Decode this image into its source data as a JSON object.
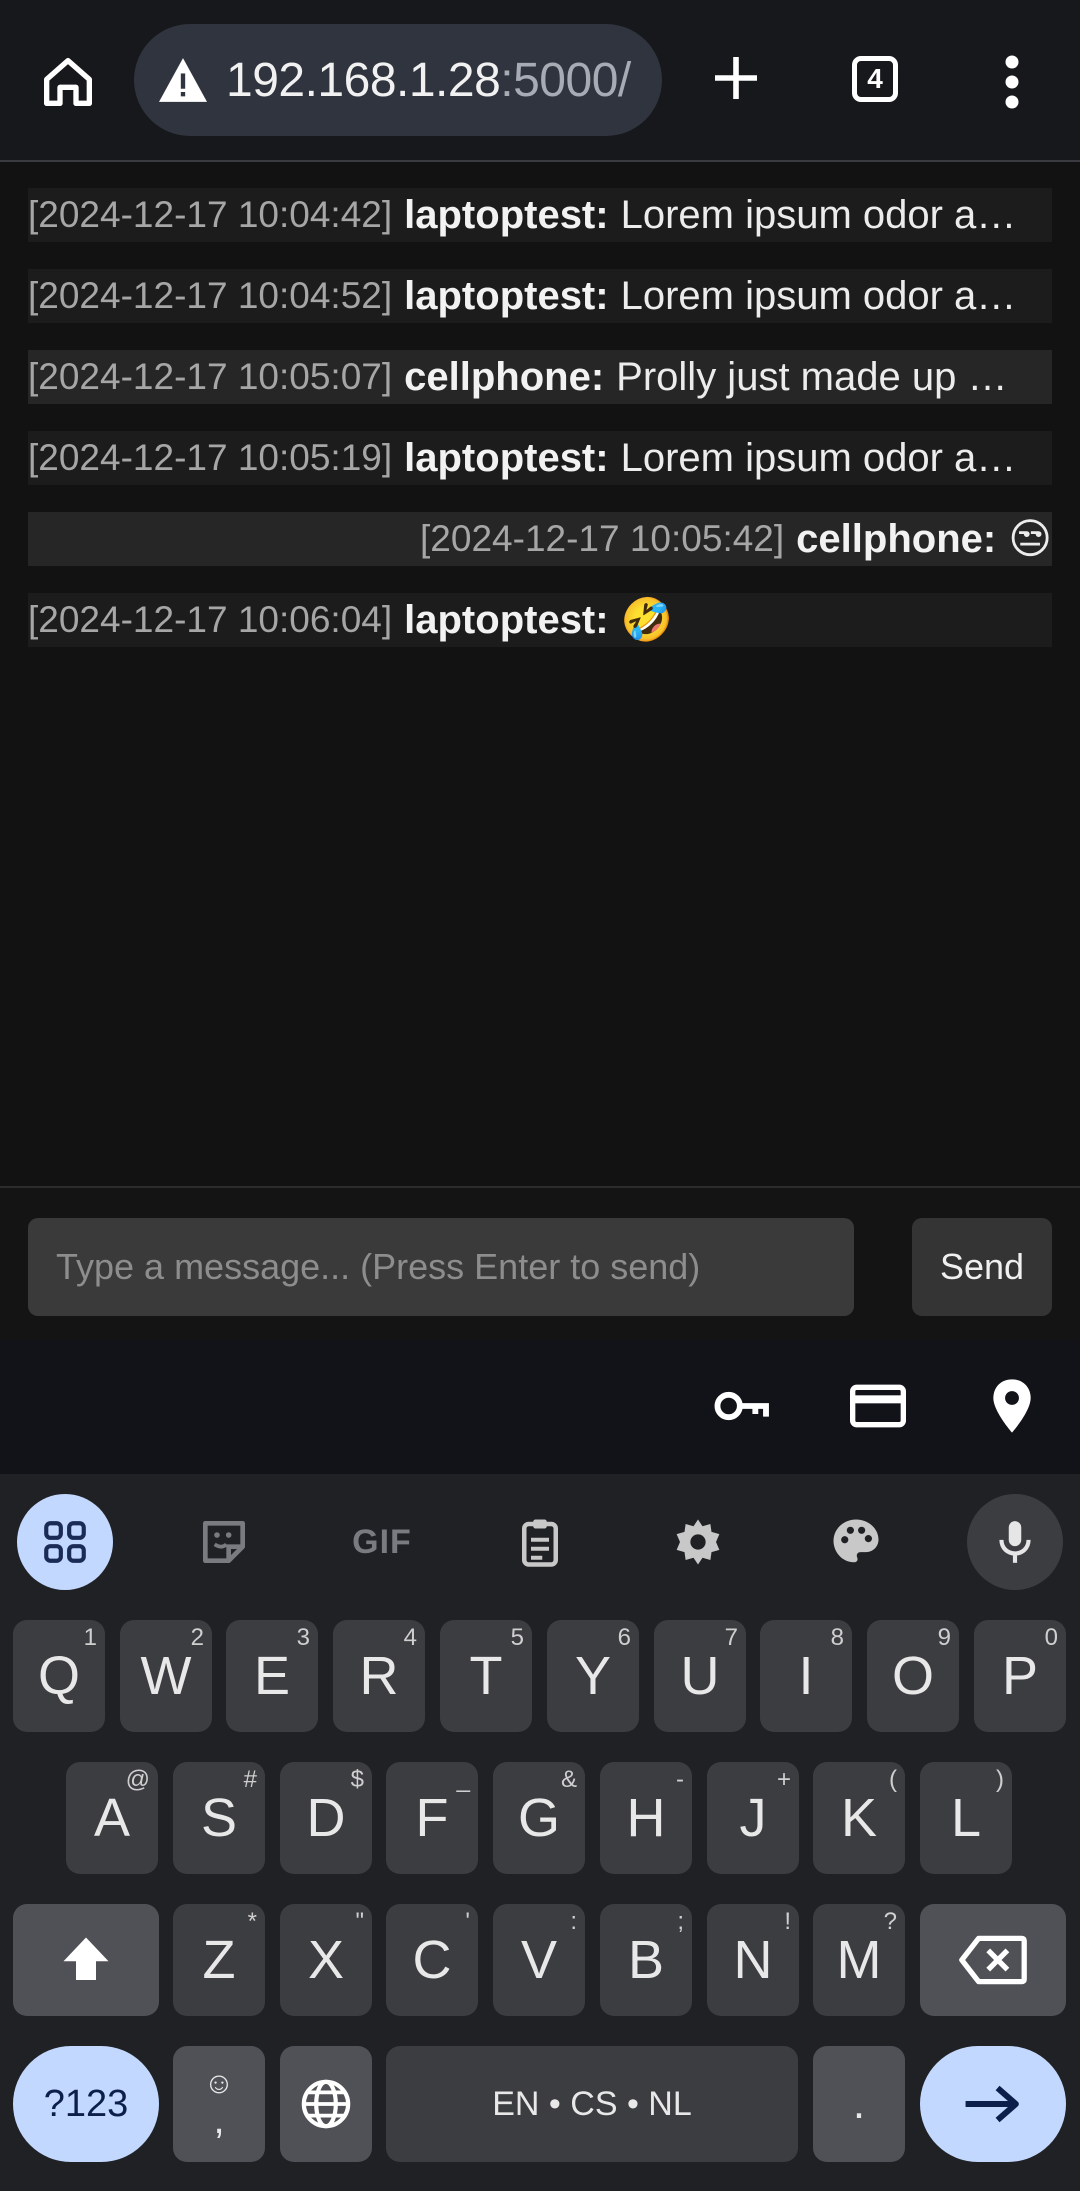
{
  "browser": {
    "url_host": "192.168.1.28",
    "url_port": ":5000/",
    "tab_count": "4"
  },
  "messages": [
    {
      "timestamp": "[2024-12-17 10:04:42]",
      "user": "laptoptest:",
      "text": "Lorem ipsum odor a…"
    },
    {
      "timestamp": "[2024-12-17 10:04:52]",
      "user": "laptoptest:",
      "text": "Lorem ipsum odor a…"
    },
    {
      "timestamp": "[2024-12-17 10:05:07]",
      "user": "cellphone:",
      "text": "Prolly just made up …"
    },
    {
      "timestamp": "[2024-12-17 10:05:19]",
      "user": "laptoptest:",
      "text": "Lorem ipsum odor a…"
    },
    {
      "timestamp": "[2024-12-17 10:05:42]",
      "user": "cellphone:",
      "text": "😒"
    },
    {
      "timestamp": "[2024-12-17 10:06:04]",
      "user": "laptoptest:",
      "text": "🤣"
    }
  ],
  "composer": {
    "placeholder": "Type a message... (Press Enter to send)",
    "send_label": "Send"
  },
  "keyboard": {
    "gif_label": "GIF",
    "row1": [
      {
        "label": "Q",
        "sup": "1"
      },
      {
        "label": "W",
        "sup": "2"
      },
      {
        "label": "E",
        "sup": "3"
      },
      {
        "label": "R",
        "sup": "4"
      },
      {
        "label": "T",
        "sup": "5"
      },
      {
        "label": "Y",
        "sup": "6"
      },
      {
        "label": "U",
        "sup": "7"
      },
      {
        "label": "I",
        "sup": "8"
      },
      {
        "label": "O",
        "sup": "9"
      },
      {
        "label": "P",
        "sup": "0"
      }
    ],
    "row2": [
      {
        "label": "A",
        "sup": "@"
      },
      {
        "label": "S",
        "sup": "#"
      },
      {
        "label": "D",
        "sup": "$"
      },
      {
        "label": "F",
        "sup": "_"
      },
      {
        "label": "G",
        "sup": "&"
      },
      {
        "label": "H",
        "sup": "-"
      },
      {
        "label": "J",
        "sup": "+"
      },
      {
        "label": "K",
        "sup": "("
      },
      {
        "label": "L",
        "sup": ")"
      }
    ],
    "row3": [
      {
        "label": "Z",
        "sup": "*"
      },
      {
        "label": "X",
        "sup": "\""
      },
      {
        "label": "C",
        "sup": "'"
      },
      {
        "label": "V",
        "sup": ":"
      },
      {
        "label": "B",
        "sup": ";"
      },
      {
        "label": "N",
        "sup": "!"
      },
      {
        "label": "M",
        "sup": "?"
      }
    ],
    "symbols_label": "?123",
    "emoji_comma_label": ",",
    "space_label": "EN • CS • NL",
    "period_label": "."
  },
  "colors": {
    "accent": "#c3d8ff",
    "background": "#121212",
    "key": "#3c3d41"
  }
}
